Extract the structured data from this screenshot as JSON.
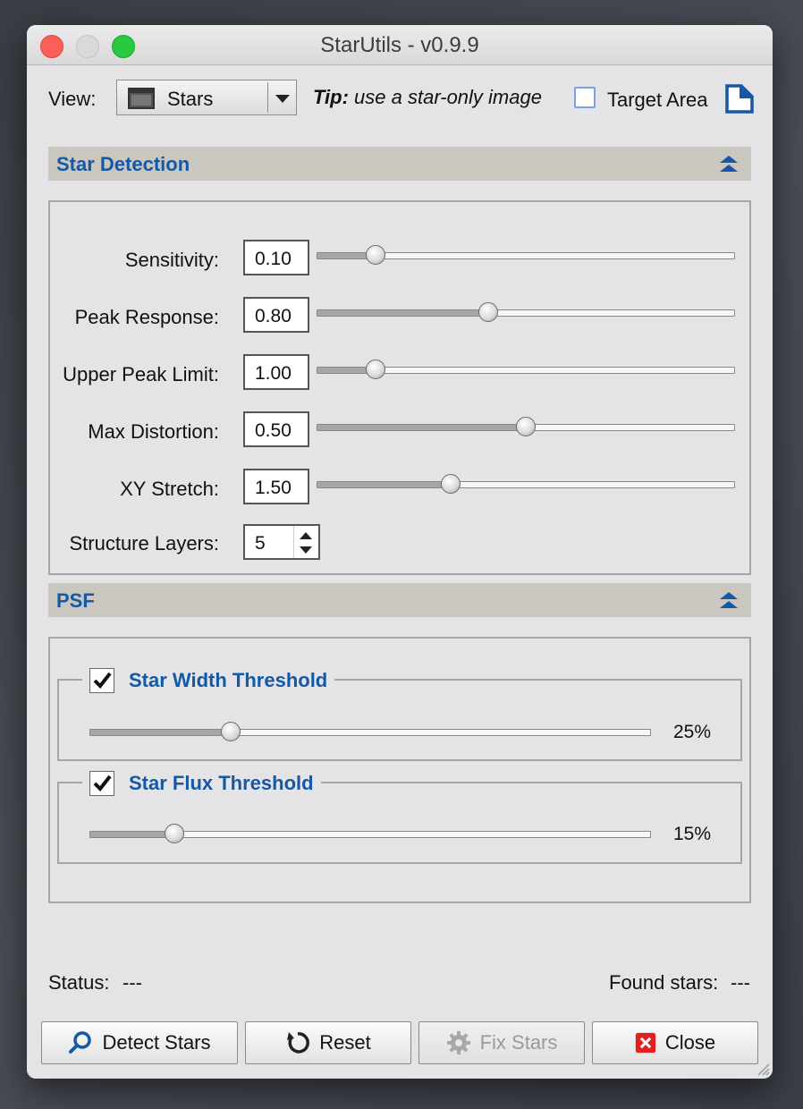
{
  "window": {
    "title": "StarUtils - v0.9.9"
  },
  "toolbar": {
    "view_label": "View:",
    "view_value": "Stars",
    "tip_bold": "Tip:",
    "tip_text": " use a star-only image",
    "target_area_label": "Target Area",
    "target_area_checked": false
  },
  "star_detection": {
    "header": "Star Detection",
    "params": [
      {
        "label": "Sensitivity:",
        "value": "0.10",
        "level": 0.14
      },
      {
        "label": "Peak Response:",
        "value": "0.80",
        "level": 0.41
      },
      {
        "label": "Upper Peak Limit:",
        "value": "1.00",
        "level": 0.14
      },
      {
        "label": "Max Distortion:",
        "value": "0.50",
        "level": 0.5
      },
      {
        "label": "XY Stretch:",
        "value": "1.50",
        "level": 0.32
      }
    ],
    "structure_layers_label": "Structure Layers:",
    "structure_layers_value": "5"
  },
  "psf": {
    "header": "PSF",
    "width_threshold": {
      "label": "Star Width Threshold",
      "checked": true,
      "value": "25%",
      "level": 0.25
    },
    "flux_threshold": {
      "label": "Star Flux Threshold",
      "checked": true,
      "value": "15%",
      "level": 0.15
    }
  },
  "status": {
    "status_label": "Status:",
    "status_value": "---",
    "found_label": "Found stars:",
    "found_value": "---"
  },
  "buttons": {
    "detect": "Detect Stars",
    "reset": "Reset",
    "fix": "Fix Stars",
    "close": "Close"
  },
  "colors": {
    "section_title": "#1458a6",
    "section_header_bg": "#c9c7bf",
    "close_icon": "#e02020"
  }
}
